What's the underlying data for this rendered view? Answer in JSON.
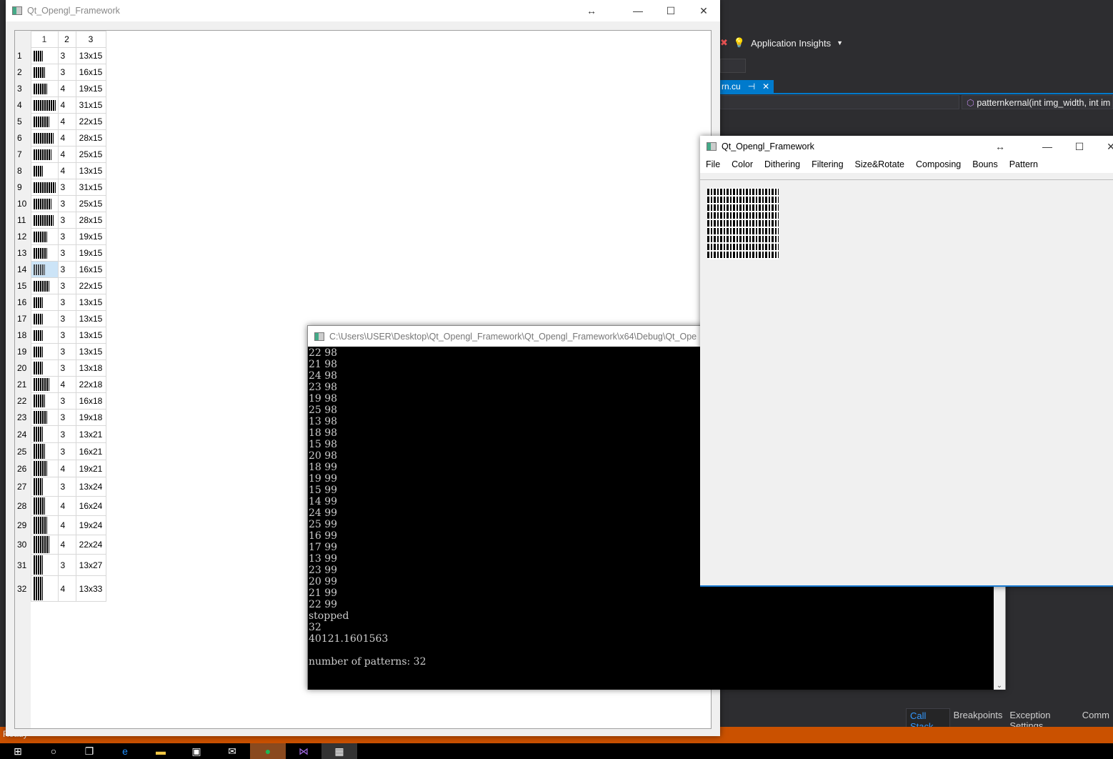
{
  "vs": {
    "toolbar_label": "Application Insights",
    "doc_tab": "rn.cu",
    "nav_member": "patternkernal(int img_width, int im",
    "bottom_tabs": [
      "Call Stack",
      "Breakpoints",
      "Exception Settings",
      "Comm"
    ],
    "status": "Ready",
    "accent": "#007acc",
    "status_color": "#ca5100"
  },
  "taskbar": {
    "items": [
      "windows-start",
      "search",
      "task-view",
      "edge",
      "file-explorer",
      "store",
      "mail",
      "spotify",
      "visual-studio",
      "qt-app"
    ]
  },
  "left_window": {
    "title": "Qt_Opengl_Framework",
    "columns": [
      "1",
      "2",
      "3"
    ],
    "rows": [
      [
        "3",
        "13x15"
      ],
      [
        "3",
        "16x15"
      ],
      [
        "4",
        "19x15"
      ],
      [
        "4",
        "31x15"
      ],
      [
        "4",
        "22x15"
      ],
      [
        "4",
        "28x15"
      ],
      [
        "4",
        "25x15"
      ],
      [
        "4",
        "13x15"
      ],
      [
        "3",
        "31x15"
      ],
      [
        "3",
        "25x15"
      ],
      [
        "3",
        "28x15"
      ],
      [
        "3",
        "19x15"
      ],
      [
        "3",
        "19x15"
      ],
      [
        "3",
        "16x15"
      ],
      [
        "3",
        "22x15"
      ],
      [
        "3",
        "13x15"
      ],
      [
        "3",
        "13x15"
      ],
      [
        "3",
        "13x15"
      ],
      [
        "3",
        "13x15"
      ],
      [
        "3",
        "13x18"
      ],
      [
        "4",
        "22x18"
      ],
      [
        "3",
        "16x18"
      ],
      [
        "3",
        "19x18"
      ],
      [
        "3",
        "13x21"
      ],
      [
        "3",
        "16x21"
      ],
      [
        "4",
        "19x21"
      ],
      [
        "3",
        "13x24"
      ],
      [
        "4",
        "16x24"
      ],
      [
        "4",
        "19x24"
      ],
      [
        "4",
        "22x24"
      ],
      [
        "3",
        "13x27"
      ],
      [
        "4",
        "13x33"
      ]
    ],
    "selected_row": 14
  },
  "console": {
    "title": "C:\\Users\\USER\\Desktop\\Qt_Opengl_Framework\\Qt_Opengl_Framework\\x64\\Debug\\Qt_Ope",
    "lines": [
      "22 98",
      "21 98",
      "24 98",
      "23 98",
      "19 98",
      "25 98",
      "13 98",
      "18 98",
      "15 98",
      "20 98",
      "18 99",
      "19 99",
      "15 99",
      "14 99",
      "24 99",
      "25 99",
      "16 99",
      "17 99",
      "13 99",
      "23 99",
      "20 99",
      "21 99",
      "22 99",
      "stopped",
      "32",
      "40121.1601563",
      "",
      "number of patterns: 32"
    ]
  },
  "right_window": {
    "title": "Qt_Opengl_Framework",
    "menu": [
      "File",
      "Color",
      "Dithering",
      "Filtering",
      "Size&Rotate",
      "Composing",
      "Bouns",
      "Pattern"
    ]
  }
}
